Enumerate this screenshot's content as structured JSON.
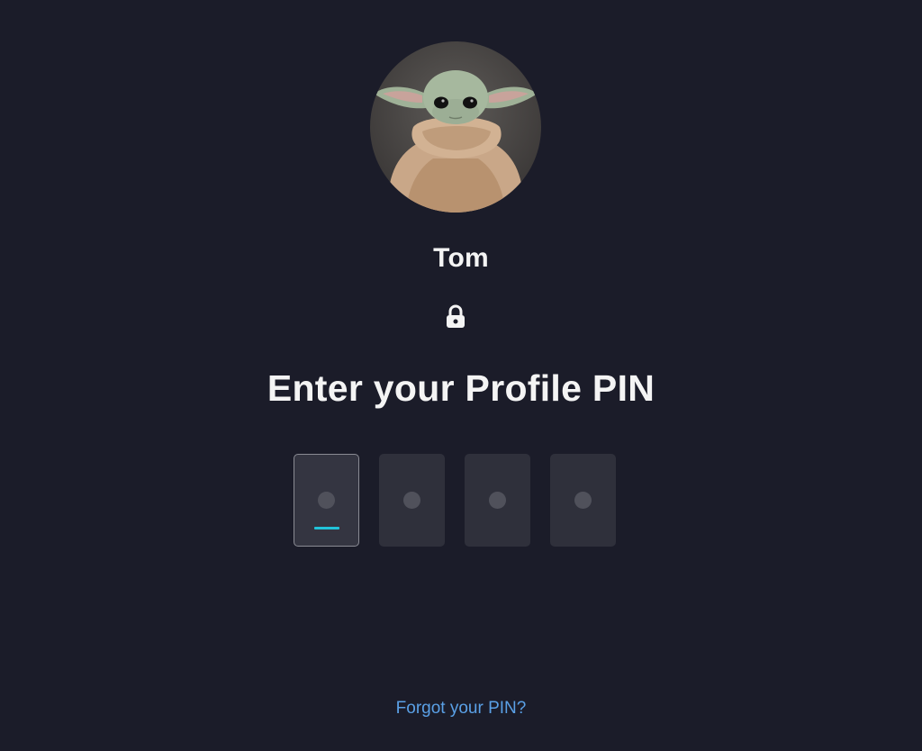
{
  "profile": {
    "name": "Tom",
    "avatar_icon": "baby-yoda-avatar"
  },
  "lock_icon": "lock-icon",
  "prompt": {
    "heading": "Enter your Profile PIN"
  },
  "pin": {
    "length": 4,
    "entered": 0,
    "focused_index": 0,
    "accent_color": "#21c3d9"
  },
  "links": {
    "forgot_pin": "Forgot your PIN?"
  },
  "colors": {
    "background": "#1b1c29",
    "link": "#5aa0e6",
    "text": "#f4f4f4"
  }
}
